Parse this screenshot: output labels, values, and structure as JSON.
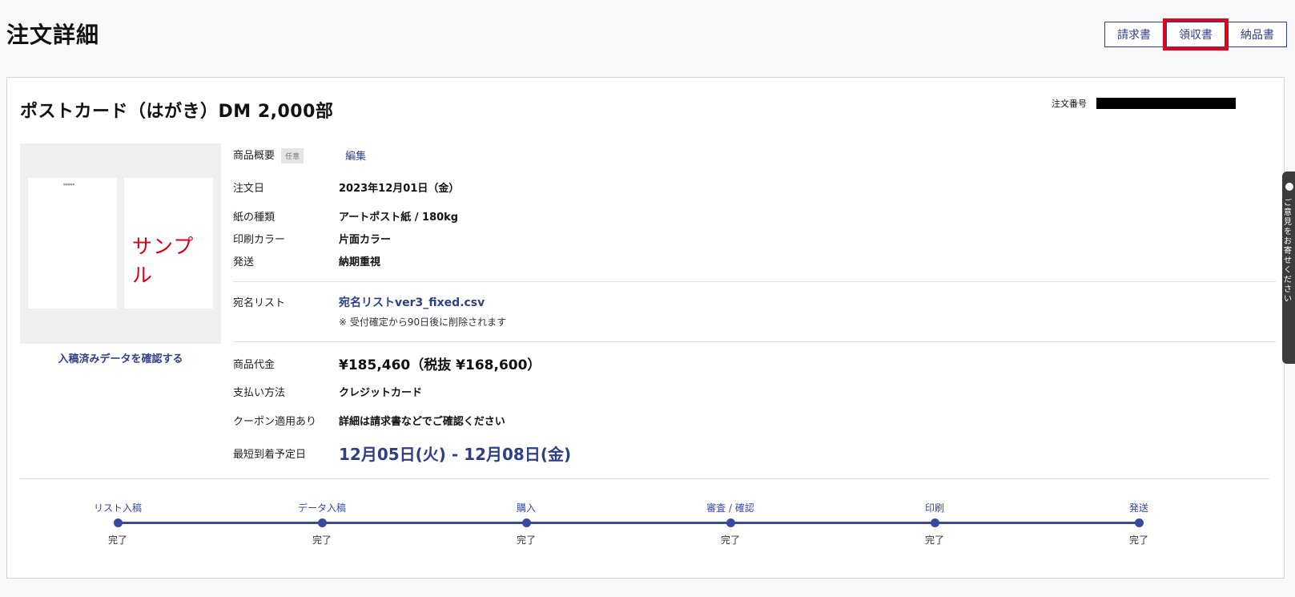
{
  "page": {
    "title": "注文詳細"
  },
  "doc_buttons": [
    {
      "label": "請求書",
      "highlighted": false
    },
    {
      "label": "領収書",
      "highlighted": true
    },
    {
      "label": "納品書",
      "highlighted": false
    }
  ],
  "order": {
    "product_title": "ポストカード（はがき）DM  2,000部",
    "order_no_label": "注文番号"
  },
  "preview": {
    "sample_text": "サンプル",
    "confirm_link": "入稿済みデータを確認する"
  },
  "details": {
    "summary_label": "商品概要",
    "optional_badge": "任意",
    "edit_link": "編集",
    "order_date_label": "注文日",
    "order_date": "2023年12月01日（金）",
    "paper_label": "紙の種類",
    "paper": "アートポスト紙 / 180kg",
    "color_label": "印刷カラー",
    "color": "片面カラー",
    "shipping_label": "発送",
    "shipping": "納期重視",
    "address_list_label": "宛名リスト",
    "address_list_file": "宛名リストver3_fixed.csv",
    "address_list_note": "※ 受付確定から90日後に削除されます",
    "price_label": "商品代金",
    "price": "¥185,460（税抜 ¥168,600）",
    "payment_label": "支払い方法",
    "payment": "クレジットカード",
    "coupon_label": "クーポン適用あり",
    "coupon": "詳細は請求書などでご確認ください",
    "arrival_label": "最短到着予定日",
    "arrival": "12月05日(火) - 12月08日(金)"
  },
  "progress": {
    "steps": [
      {
        "label": "リスト入稿",
        "status": "完了"
      },
      {
        "label": "データ入稿",
        "status": "完了"
      },
      {
        "label": "購入",
        "status": "完了"
      },
      {
        "label": "審査 / 確認",
        "status": "完了"
      },
      {
        "label": "印刷",
        "status": "完了"
      },
      {
        "label": "発送",
        "status": "完了"
      }
    ]
  },
  "feedback": {
    "label": "ご意見をお寄せください"
  },
  "colors": {
    "accent": "#2f3f85",
    "highlight": "#e2001a",
    "sample": "#d0021b"
  }
}
